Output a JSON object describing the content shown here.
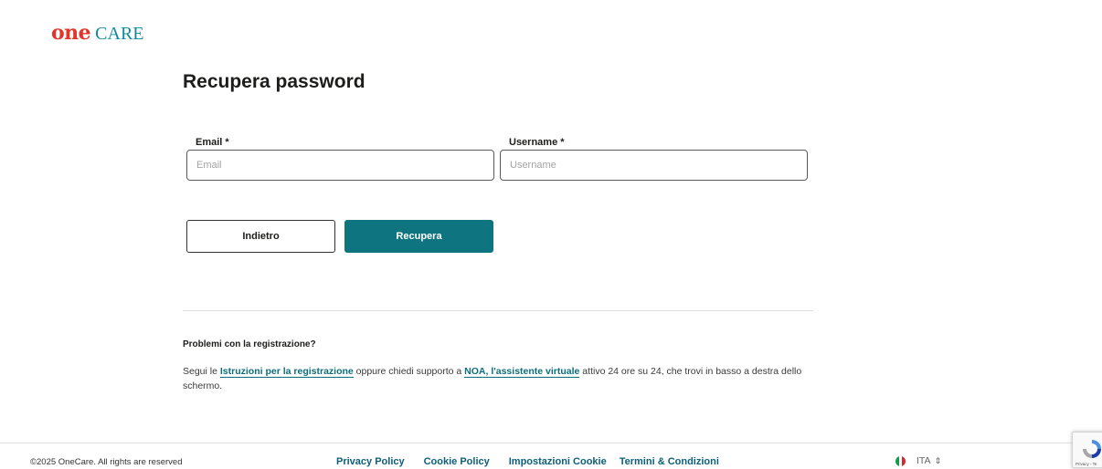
{
  "logo": {
    "part1": "one",
    "part2": "CARE"
  },
  "page": {
    "title": "Recupera password"
  },
  "form": {
    "email_label": "Email *",
    "email_placeholder": "Email",
    "email_value": "",
    "username_label": "Username *",
    "username_placeholder": "Username",
    "username_value": ""
  },
  "actions": {
    "back_label": "Indietro",
    "recover_label": "Recupera"
  },
  "colors": {
    "brand_red": "#e4352a",
    "brand_teal": "#0e8aa0",
    "primary_button": "#0d7480"
  },
  "help": {
    "title": "Problemi con la registrazione?",
    "text_1": "Segui le ",
    "link_1": "Istruzioni per la registrazione",
    "text_2": " oppure chiedi supporto a ",
    "link_2": "NOA, l'assistente virtuale",
    "text_3": " attivo 24 ore su 24, che trovi in basso a destra dello schermo."
  },
  "footer": {
    "copyright": "©2025 OneCare. All rights are reserved",
    "links": [
      "Privacy Policy",
      "Cookie Policy",
      "Impostazioni Cookie",
      "Termini & Condizioni"
    ],
    "language": {
      "flag_icon": "italy-flag-icon",
      "code": "ITA",
      "caret_icon": "updown-caret-icon"
    }
  },
  "recaptcha": {
    "icon": "recaptcha-icon",
    "text": "Privacy - Te"
  }
}
